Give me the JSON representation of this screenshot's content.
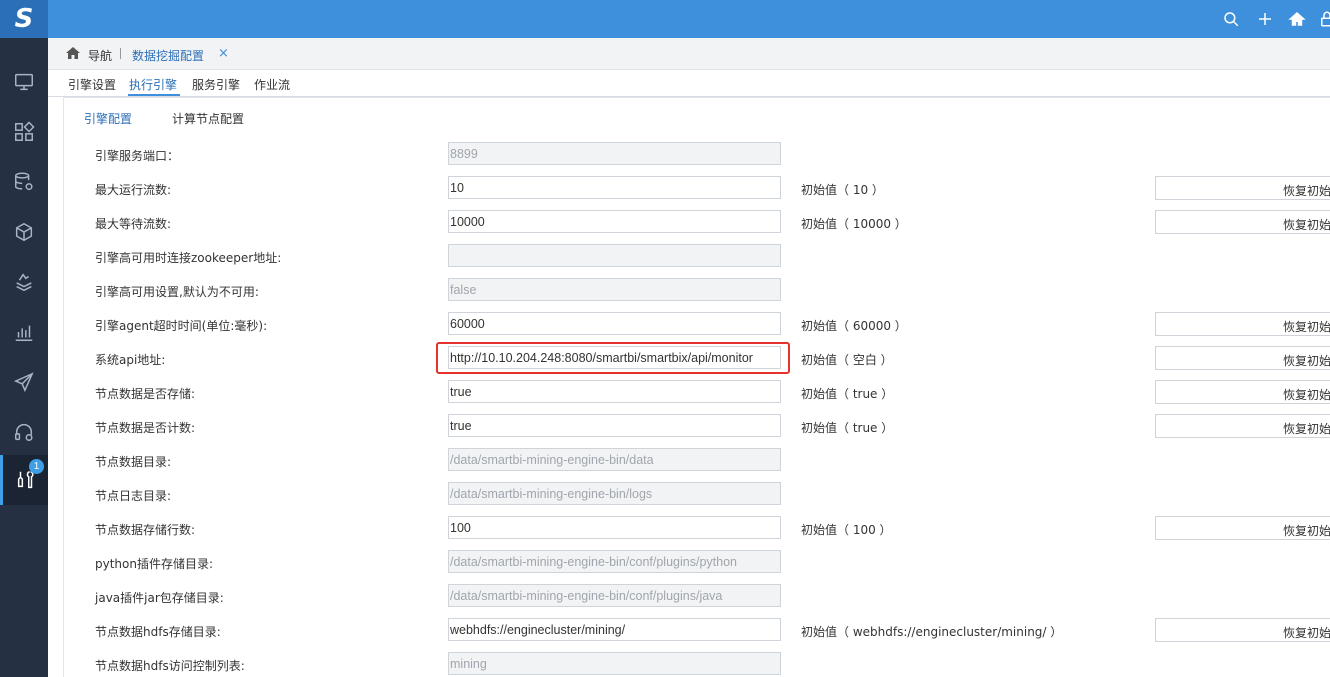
{
  "app": {
    "logo": "S",
    "notification_count": "1"
  },
  "sidebar": {
    "icons": [
      "monitor-icon",
      "apps-icon",
      "database-settings-icon",
      "cube-icon",
      "layers-chart-icon",
      "bar-chart-icon",
      "send-icon",
      "headset-icon",
      "tools-icon"
    ],
    "active_index": 8
  },
  "topbar": {
    "icons": [
      "search-icon",
      "plus-icon",
      "home-icon",
      "lock-icon"
    ]
  },
  "breadcrumb": {
    "nav": "导航",
    "tab": "数据挖掘配置",
    "close": "×"
  },
  "subtabs": [
    "引擎设置",
    "执行引擎",
    "服务引擎",
    "作业流"
  ],
  "active_subtab": "执行引擎",
  "inner_tabs": [
    "引擎配置",
    "计算节点配置"
  ],
  "active_inner_tab": "引擎配置",
  "reset_label": "恢复初始",
  "rows": [
    {
      "label": "引擎服务端口：",
      "value": "8899",
      "disabled": true,
      "init": ""
    },
    {
      "label": "最大运行流数:",
      "value": "10",
      "disabled": false,
      "init": "初始值（ 10 ）"
    },
    {
      "label": "最大等待流数:",
      "value": "10000",
      "disabled": false,
      "init": "初始值（ 10000 ）"
    },
    {
      "label": "引擎高可用时连接zookeeper地址:",
      "value": "",
      "disabled": true,
      "init": ""
    },
    {
      "label": "引擎高可用设置,默认为不可用:",
      "value": "false",
      "disabled": true,
      "init": ""
    },
    {
      "label": "引擎agent超时时间(单位:毫秒):",
      "value": "60000",
      "disabled": false,
      "init": "初始值（ 60000 ）"
    },
    {
      "label": "系统api地址:",
      "value": "http://10.10.204.248:8080/smartbi/smartbix/api/monitor",
      "disabled": false,
      "init": "初始值（ 空白 ）"
    },
    {
      "label": "节点数据是否存储:",
      "value": "true",
      "disabled": false,
      "init": "初始值（ true ）"
    },
    {
      "label": "节点数据是否计数:",
      "value": "true",
      "disabled": false,
      "init": "初始值（ true ）"
    },
    {
      "label": "节点数据目录:",
      "value": "/data/smartbi-mining-engine-bin/data",
      "disabled": true,
      "init": ""
    },
    {
      "label": "节点日志目录:",
      "value": "/data/smartbi-mining-engine-bin/logs",
      "disabled": true,
      "init": ""
    },
    {
      "label": "节点数据存储行数:",
      "value": "100",
      "disabled": false,
      "init": "初始值（ 100 ）"
    },
    {
      "label": "python插件存储目录:",
      "value": "/data/smartbi-mining-engine-bin/conf/plugins/python",
      "disabled": true,
      "init": ""
    },
    {
      "label": "java插件jar包存储目录:",
      "value": "/data/smartbi-mining-engine-bin/conf/plugins/java",
      "disabled": true,
      "init": ""
    },
    {
      "label": "节点数据hdfs存储目录:",
      "value": "webhdfs://enginecluster/mining/",
      "disabled": false,
      "init": "初始值（ webhdfs://enginecluster/mining/ ）"
    },
    {
      "label": "节点数据hdfs访问控制列表:",
      "value": "mining",
      "disabled": true,
      "init": ""
    }
  ],
  "colors": {
    "topbar": "#3e8fdc",
    "sidebar": "#253143",
    "accent": "#2b6fb8",
    "highlight": "#e5322d"
  }
}
